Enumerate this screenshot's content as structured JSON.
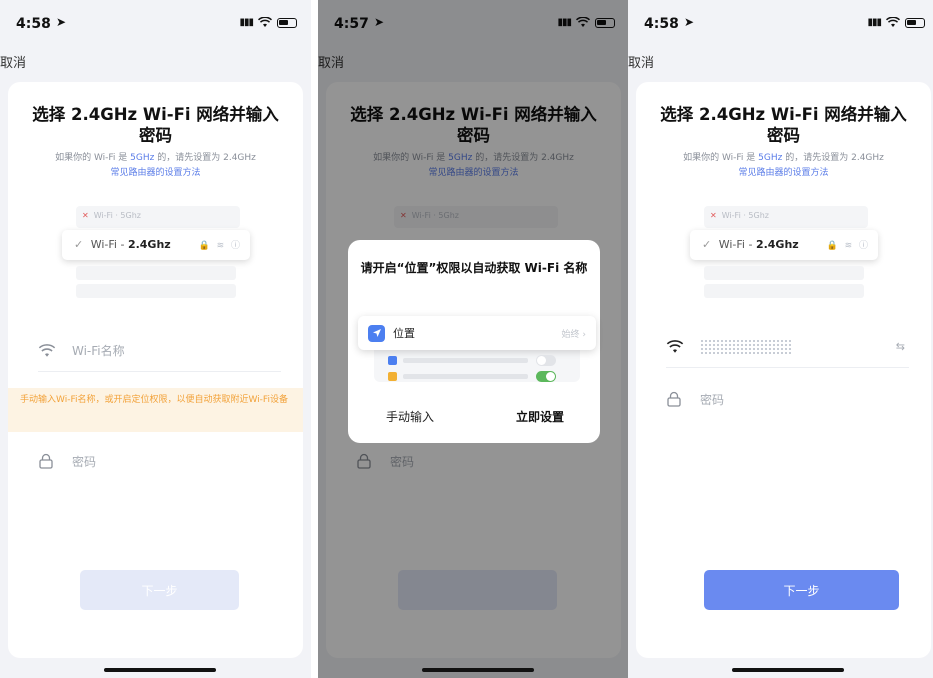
{
  "screens": [
    {
      "time": "4:58",
      "cancel": "取消",
      "title_line1": "选择 2.4GHz Wi-Fi 网络并输入",
      "title_line2": "密码",
      "hint_pre": "如果你的 Wi-Fi 是",
      "hint_accent": "5GHz",
      "hint_post": "的，请先设置为 2.4GHz",
      "help_link": "常见路由器的设置方法",
      "illus_bad_text": "Wi-Fi · 5Ghz",
      "illus_good_prefix": "Wi-Fi -",
      "illus_good_bold": "2.4Ghz",
      "wifi_placeholder": "Wi-Fi名称",
      "warning": "手动输入Wi-Fi名称，或开启定位权限，以便自动获取附近Wi-Fi设备",
      "password_placeholder": "密码",
      "next_label": "下一步"
    },
    {
      "time": "4:57",
      "cancel": "取消",
      "title_line1": "选择 2.4GHz Wi-Fi 网络并输入",
      "title_line2": "密码",
      "hint_pre": "如果你的 Wi-Fi 是",
      "hint_accent": "5GHz",
      "hint_post": "的，请先设置为 2.4GHz",
      "help_link": "常见路由器的设置方法",
      "illus_bad_text": "Wi-Fi · 5Ghz",
      "password_placeholder": "密码",
      "dialog": {
        "title": "请开启“位置”权限以自动获取 Wi-Fi 名称",
        "location_label": "位置",
        "location_value": "始终 ›",
        "manual_label": "手动输入",
        "setup_label": "立即设置"
      }
    },
    {
      "time": "4:58",
      "cancel": "取消",
      "title_line1": "选择 2.4GHz Wi-Fi 网络并输入",
      "title_line2": "密码",
      "hint_pre": "如果你的 Wi-Fi 是",
      "hint_accent": "5GHz",
      "hint_post": "的，请先设置为 2.4GHz",
      "help_link": "常见路由器的设置方法",
      "illus_bad_text": "Wi-Fi · 5Ghz",
      "illus_good_prefix": "Wi-Fi -",
      "illus_good_bold": "2.4Ghz",
      "password_placeholder": "密码",
      "next_label": "下一步"
    }
  ],
  "colors": {
    "accent": "#5b7de8",
    "button_active": "#6a8af0",
    "button_disabled": "#e4e9f8",
    "warning_bg": "#fdf3e3",
    "warning_text": "#f2a23a",
    "toggle_on": "#5cb85c"
  }
}
